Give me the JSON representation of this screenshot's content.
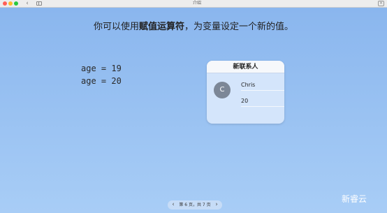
{
  "window": {
    "title": "介绍",
    "back_glyph": "‹",
    "close_glyph": "×"
  },
  "heading": {
    "part1": "你可以使用",
    "bold": "赋值运算符",
    "part2": "，为变量设定一个新的值。"
  },
  "code": {
    "line1": "age = 19",
    "line2": "age = 20"
  },
  "contact_card": {
    "title": "新联系人",
    "avatar_letter": "C",
    "name": "Chris",
    "age": "20"
  },
  "pager": {
    "left": "‹",
    "label": "第 6 页，共 7 页",
    "right": "›"
  },
  "watermark": "新睿云"
}
